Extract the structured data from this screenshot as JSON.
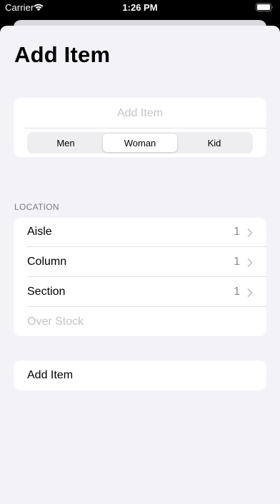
{
  "status_bar": {
    "carrier": "Carrier",
    "time": "1:26 PM",
    "wifi_icon": "wifi-icon",
    "battery_icon": "battery-icon"
  },
  "header": {
    "title": "Add Item"
  },
  "item_form": {
    "name_placeholder": "Add Item",
    "name_value": "",
    "category_segments": [
      "Men",
      "Woman",
      "Kid"
    ],
    "selected_segment": "Woman"
  },
  "location": {
    "section_header": "LOCATION",
    "rows": [
      {
        "label": "Aisle",
        "value": "1"
      },
      {
        "label": "Column",
        "value": "1"
      },
      {
        "label": "Section",
        "value": "1"
      }
    ],
    "overstock_placeholder": "Over Stock",
    "overstock_value": ""
  },
  "actions": {
    "add_button_label": "Add Item"
  },
  "colors": {
    "background": "#f2f2f7",
    "card": "#ffffff",
    "secondary_text": "#8a8a8e",
    "placeholder": "#c4c4c8",
    "section_header": "#7b7b80"
  }
}
